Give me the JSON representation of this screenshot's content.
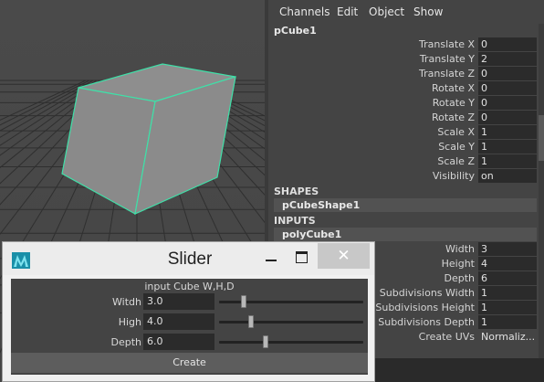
{
  "viewport": {
    "object": "pCube1"
  },
  "channel_box": {
    "menu": [
      "Channels",
      "Edit",
      "Object",
      "Show"
    ],
    "object_name": "pCube1",
    "attributes": [
      {
        "label": "Translate X",
        "value": "0"
      },
      {
        "label": "Translate Y",
        "value": "2"
      },
      {
        "label": "Translate Z",
        "value": "0"
      },
      {
        "label": "Rotate X",
        "value": "0"
      },
      {
        "label": "Rotate Y",
        "value": "0"
      },
      {
        "label": "Rotate Z",
        "value": "0"
      },
      {
        "label": "Scale X",
        "value": "1"
      },
      {
        "label": "Scale Y",
        "value": "1"
      },
      {
        "label": "Scale Z",
        "value": "1"
      },
      {
        "label": "Visibility",
        "value": "on"
      }
    ],
    "shapes_header": "SHAPES",
    "shape_node": "pCubeShape1",
    "inputs_header": "INPUTS",
    "input_node": "polyCube1",
    "input_attributes": [
      {
        "label": "Width",
        "value": "3"
      },
      {
        "label": "Height",
        "value": "4"
      },
      {
        "label": "Depth",
        "value": "6"
      },
      {
        "label": "Subdivisions Width",
        "value": "1"
      },
      {
        "label": "Subdivisions Height",
        "value": "1"
      },
      {
        "label": "Subdivisions Depth",
        "value": "1"
      },
      {
        "label": "Create UVs",
        "value": "Normaliz..."
      }
    ]
  },
  "slider_window": {
    "title": "Slider",
    "minimize_icon": "minimize-icon",
    "maximize_icon": "maximize-icon",
    "close_glyph": "✕",
    "header": "input Cube W,H,D",
    "sliders": [
      {
        "label": "Witdh",
        "value": "3.0",
        "fraction": 0.17
      },
      {
        "label": "High",
        "value": "4.0",
        "fraction": 0.22
      },
      {
        "label": "Depth",
        "value": "6.0",
        "fraction": 0.32
      }
    ],
    "create_label": "Create"
  },
  "colors": {
    "wireframe_highlight": "#3fe0a8",
    "cube_face": "#8c8c8c",
    "grid": "#2f2f2f"
  }
}
